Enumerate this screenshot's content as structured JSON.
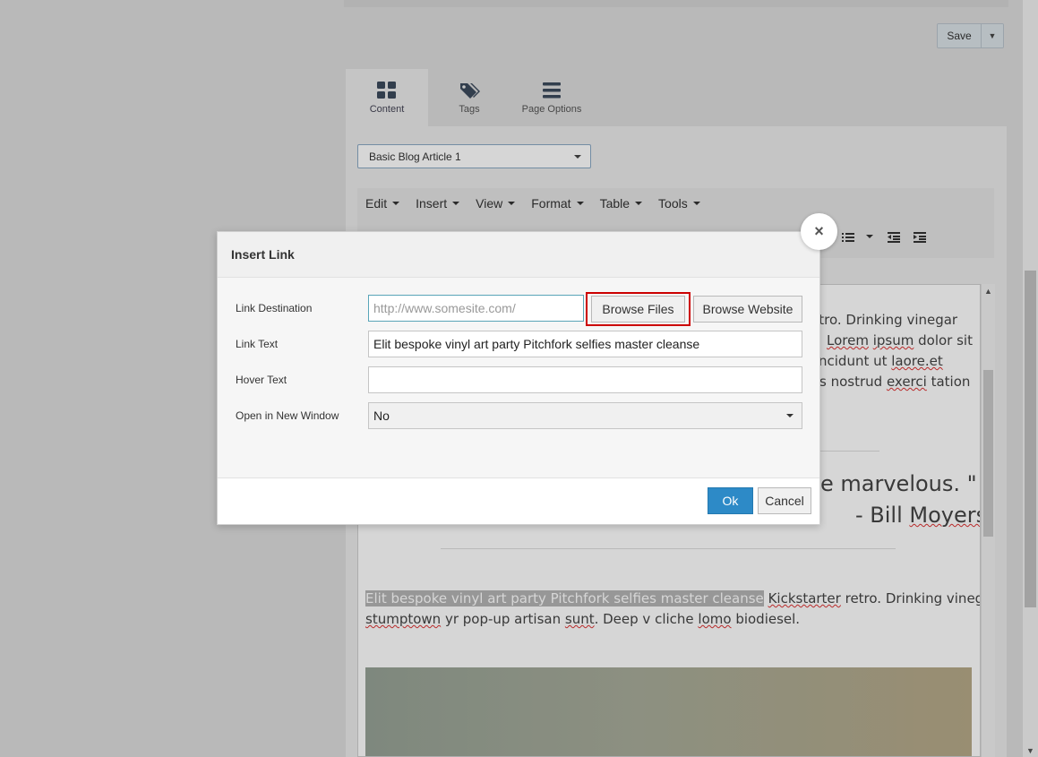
{
  "header": {
    "save_label": "Save"
  },
  "tabs": [
    {
      "label": "Content",
      "icon": "grid-icon"
    },
    {
      "label": "Tags",
      "icon": "tags-icon"
    },
    {
      "label": "Page Options",
      "icon": "menu-lines-icon"
    }
  ],
  "template_select": {
    "value": "Basic Blog Article 1"
  },
  "editor": {
    "menus": [
      "Edit",
      "Insert",
      "View",
      "Format",
      "Table",
      "Tools"
    ],
    "lines": {
      "l1": "etro. Drinking vinegar",
      "l2a": "Lorem",
      "l2b": " ",
      "l2c": "ipsum",
      "l2d": " dolor sit",
      "l3a": "ncidunt ut ",
      "l3b": "laore.et",
      "l4a": "s nostrud ",
      "l4b": "exerci",
      "l4c": " tation",
      "quote1": "e marvelous. \"",
      "quote2a": "- Bill ",
      "quote2b": "Moyers",
      "p_hl": "Elit bespoke vinyl art party Pitchfork selfies master cleanse",
      "p_rest_a": " ",
      "p_rest_b": "Kickstarter",
      "p_rest_c": " retro. Drinking vinegar",
      "p2a": "stumptown",
      "p2b": " yr pop-up artisan ",
      "p2c": "sunt",
      "p2d": ". Deep v cliche ",
      "p2e": "lomo",
      "p2f": " biodiesel."
    }
  },
  "dialog": {
    "title": "Insert Link",
    "close_label": "×",
    "link_destination_label": "Link Destination",
    "link_destination_placeholder": "http://www.somesite.com/",
    "browse_files_label": "Browse Files",
    "browse_website_label": "Browse Website",
    "link_text_label": "Link Text",
    "link_text_value": "Elit bespoke vinyl art party Pitchfork selfies master cleanse",
    "hover_text_label": "Hover Text",
    "hover_text_value": "",
    "new_window_label": "Open in New Window",
    "new_window_value": "No",
    "ok_label": "Ok",
    "cancel_label": "Cancel"
  },
  "colors": {
    "primary_button": "#2d8ac7",
    "highlight_border": "#cc0000"
  }
}
